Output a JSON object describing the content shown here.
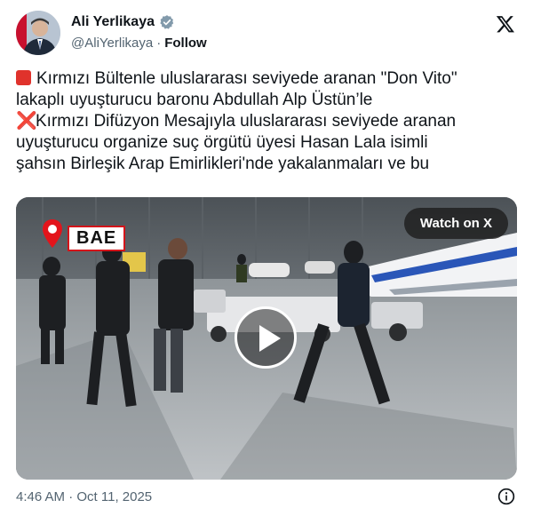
{
  "author": {
    "name": "Ali Yerlikaya",
    "handle": "@AliYerlikaya",
    "separator": "·",
    "follow_label": "Follow"
  },
  "post": {
    "lines": [
      "Kırmızı Bültenle uluslararası seviyede aranan \"Don Vito\"",
      "lakaplı uyuşturucu baronu Abdullah Alp Üstün’le",
      "Kırmızı Difüzyon Mesajıyla uluslararası seviyede aranan",
      "uyuşturucu organize suç örgütü üyesi Hasan Lala isimli",
      "şahsın Birleşik Arap Emirlikleri'nde yakalanmaları ve bu"
    ],
    "line1_icon": "red-square-emoji",
    "line3_icon": "red-cross-mark-emoji",
    "cross_glyph": "❌"
  },
  "media": {
    "watch_label": "Watch on X",
    "overlay_label": "BAE",
    "play_icon": "play-icon"
  },
  "footer": {
    "timestamp": "4:46 AM · Oct 11, 2025",
    "info_icon": "info-icon"
  },
  "colors": {
    "text": "#0f1419",
    "secondary": "#536471",
    "verified": "#829aab",
    "alert_red": "#e0322c"
  }
}
